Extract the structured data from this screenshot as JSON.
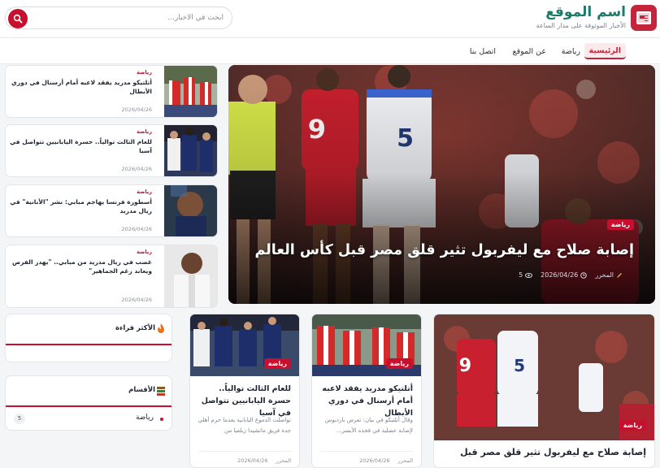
{
  "site": {
    "name": "اسم الموقع",
    "tagline": "الأخبار الموثوقة على مدار الساعة"
  },
  "search": {
    "placeholder": "ابحث في الأخبار..."
  },
  "nav": {
    "items": [
      {
        "label": "الرئيسية",
        "active": true
      },
      {
        "label": "رياضة",
        "active": false
      },
      {
        "label": "عن الموقع",
        "active": false
      },
      {
        "label": "اتصل بنا",
        "active": false
      }
    ]
  },
  "hero": {
    "category": "رياضة",
    "title": "إصابة صلاح مع ليفربول تثير قلق مصر قبل كأس العالم",
    "author": "المحرر",
    "date": "2026/04/26",
    "views": "5"
  },
  "side_articles": [
    {
      "category": "رياضة",
      "title": "أتلتيكو مدريد يفقد لاعبه أمام أرسنال في دوري الأبطال",
      "date": "2026/04/26"
    },
    {
      "category": "رياضة",
      "title": "للعام الثالث توالياً.. حسرة اليابانيين تتواصل في آسيا",
      "date": "2026/04/26"
    },
    {
      "category": "رياضة",
      "title": "أسطورة فرنسا يهاجم مبابي: نشر \"الأنانية\" في ريال مدريد",
      "date": "2026/04/26"
    },
    {
      "category": "رياضة",
      "title": "غضب في ريال مدريد من مبابي.. \"يهدر الفرص ويعاند رغم الجماهير\"",
      "date": "2026/04/26"
    }
  ],
  "widgets": {
    "most_read": {
      "title": "الأكثر قراءة"
    },
    "sections": {
      "title": "الأقسام",
      "items": [
        {
          "name": "رياضة",
          "count": "5"
        }
      ]
    }
  },
  "cards": [
    {
      "category": "رياضة",
      "title": "إصابة صلاح مع ليفربول تثير قلق مصر قبل"
    },
    {
      "category": "رياضة",
      "title": "أتلتيكو مدريد يفقد لاعبه أمام أرسنال في دوري الأبطال",
      "excerpt": "وقال أتلتيكو في بيان: تعرض بارديوس لإصابة عضلية في فخذه الأيسر...",
      "date": "2026/04/26",
      "author": "المحرر"
    },
    {
      "category": "رياضة",
      "title": "للعام الثالث توالياً.. حسرة اليابانيين تتواصل في آسيا",
      "excerpt": "تواصلت الدموع اليابانية بعدما حرم أهلي جدة فريق ماتشيدا زيلفيا من",
      "date": "2026/04/26",
      "author": "المحرر"
    }
  ],
  "colors": {
    "accent": "#c8102e",
    "brand": "#1e7a6a"
  }
}
